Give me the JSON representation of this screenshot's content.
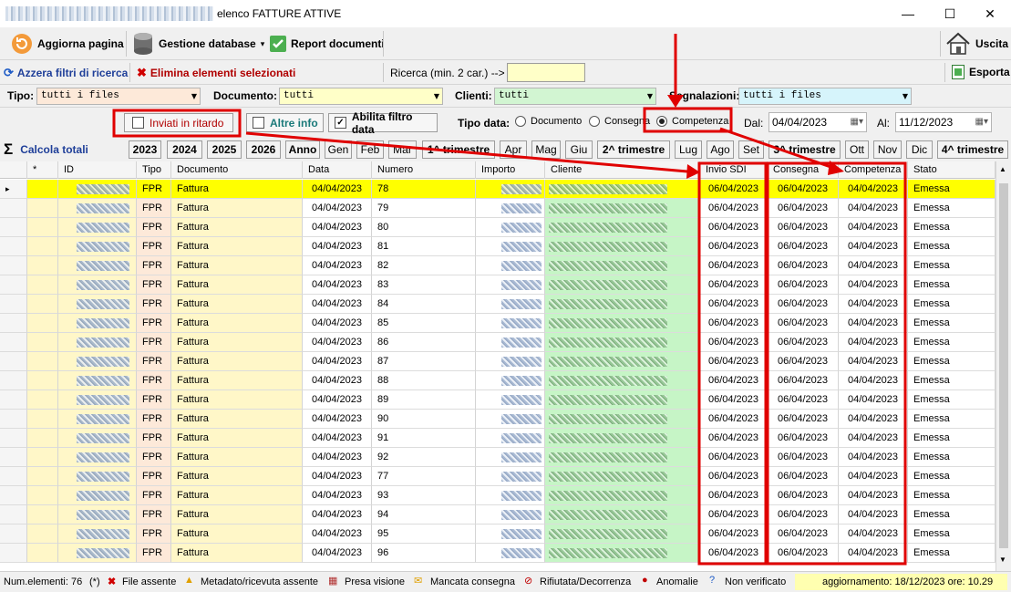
{
  "window": {
    "title": "elenco FATTURE ATTIVE",
    "minimize": "—",
    "maximize": "☐",
    "close": "✕"
  },
  "toolbar": {
    "refresh_label": "Aggiorna pagina",
    "db_label": "Gestione database",
    "db_arrow": "▾",
    "report_label": "Report documenti",
    "exit_label": "Uscita"
  },
  "filters_bar": {
    "reset_label": "Azzera filtri di ricerca",
    "delete_label": "Elimina elementi selezionati",
    "search_label": "Ricerca  (min. 2 car.) -->",
    "search_value": "",
    "export_label": "Esporta"
  },
  "combos": {
    "tipo_label": "Tipo:",
    "tipo_value": "tutti i files",
    "documento_label": "Documento:",
    "documento_value": "tutti",
    "clienti_label": "Clienti:",
    "clienti_value": "tutti",
    "segnalazioni_label": "Segnalazioni:",
    "segnalazioni_value": "tutti i files"
  },
  "options": {
    "ritardo_label": "Inviati in ritardo",
    "altre_label": "Altre info",
    "abilita_label": "Abilita filtro data",
    "tipo_data_label": "Tipo data:",
    "radio_documento": "Documento",
    "radio_consegna": "Consegna",
    "radio_competenza": "Competenza",
    "dal_label": "Dal:",
    "dal_value": "04/04/2023",
    "al_label": "Al:",
    "al_value": "11/12/2023"
  },
  "periods": {
    "calc_label": "Calcola totali",
    "buttons": [
      "2023",
      "2024",
      "2025",
      "2026",
      "Anno",
      "Gen",
      "Feb",
      "Mar",
      "1^ trimestre",
      "Apr",
      "Mag",
      "Giu",
      "2^ trimestre",
      "Lug",
      "Ago",
      "Set",
      "3^ trimestre",
      "Ott",
      "Nov",
      "Dic",
      "4^ trimestre"
    ]
  },
  "grid": {
    "headers": [
      "*",
      "ID",
      "Tipo",
      "Documento",
      "Data",
      "Numero",
      "Importo",
      "Cliente",
      "Invio SDI",
      "Consegna",
      "Competenza",
      "Stato"
    ],
    "rows": [
      {
        "tipo": "FPR",
        "doc": "Fattura",
        "data": "04/04/2023",
        "num": "78",
        "sdi": "06/04/2023",
        "cons": "06/04/2023",
        "comp": "04/04/2023",
        "stato": "Emessa"
      },
      {
        "tipo": "FPR",
        "doc": "Fattura",
        "data": "04/04/2023",
        "num": "79",
        "sdi": "06/04/2023",
        "cons": "06/04/2023",
        "comp": "04/04/2023",
        "stato": "Emessa"
      },
      {
        "tipo": "FPR",
        "doc": "Fattura",
        "data": "04/04/2023",
        "num": "80",
        "sdi": "06/04/2023",
        "cons": "06/04/2023",
        "comp": "04/04/2023",
        "stato": "Emessa"
      },
      {
        "tipo": "FPR",
        "doc": "Fattura",
        "data": "04/04/2023",
        "num": "81",
        "sdi": "06/04/2023",
        "cons": "06/04/2023",
        "comp": "04/04/2023",
        "stato": "Emessa"
      },
      {
        "tipo": "FPR",
        "doc": "Fattura",
        "data": "04/04/2023",
        "num": "82",
        "sdi": "06/04/2023",
        "cons": "06/04/2023",
        "comp": "04/04/2023",
        "stato": "Emessa"
      },
      {
        "tipo": "FPR",
        "doc": "Fattura",
        "data": "04/04/2023",
        "num": "83",
        "sdi": "06/04/2023",
        "cons": "06/04/2023",
        "comp": "04/04/2023",
        "stato": "Emessa"
      },
      {
        "tipo": "FPR",
        "doc": "Fattura",
        "data": "04/04/2023",
        "num": "84",
        "sdi": "06/04/2023",
        "cons": "06/04/2023",
        "comp": "04/04/2023",
        "stato": "Emessa"
      },
      {
        "tipo": "FPR",
        "doc": "Fattura",
        "data": "04/04/2023",
        "num": "85",
        "sdi": "06/04/2023",
        "cons": "06/04/2023",
        "comp": "04/04/2023",
        "stato": "Emessa"
      },
      {
        "tipo": "FPR",
        "doc": "Fattura",
        "data": "04/04/2023",
        "num": "86",
        "sdi": "06/04/2023",
        "cons": "06/04/2023",
        "comp": "04/04/2023",
        "stato": "Emessa"
      },
      {
        "tipo": "FPR",
        "doc": "Fattura",
        "data": "04/04/2023",
        "num": "87",
        "sdi": "06/04/2023",
        "cons": "06/04/2023",
        "comp": "04/04/2023",
        "stato": "Emessa"
      },
      {
        "tipo": "FPR",
        "doc": "Fattura",
        "data": "04/04/2023",
        "num": "88",
        "sdi": "06/04/2023",
        "cons": "06/04/2023",
        "comp": "04/04/2023",
        "stato": "Emessa"
      },
      {
        "tipo": "FPR",
        "doc": "Fattura",
        "data": "04/04/2023",
        "num": "89",
        "sdi": "06/04/2023",
        "cons": "06/04/2023",
        "comp": "04/04/2023",
        "stato": "Emessa"
      },
      {
        "tipo": "FPR",
        "doc": "Fattura",
        "data": "04/04/2023",
        "num": "90",
        "sdi": "06/04/2023",
        "cons": "06/04/2023",
        "comp": "04/04/2023",
        "stato": "Emessa"
      },
      {
        "tipo": "FPR",
        "doc": "Fattura",
        "data": "04/04/2023",
        "num": "91",
        "sdi": "06/04/2023",
        "cons": "06/04/2023",
        "comp": "04/04/2023",
        "stato": "Emessa"
      },
      {
        "tipo": "FPR",
        "doc": "Fattura",
        "data": "04/04/2023",
        "num": "92",
        "sdi": "06/04/2023",
        "cons": "06/04/2023",
        "comp": "04/04/2023",
        "stato": "Emessa"
      },
      {
        "tipo": "FPR",
        "doc": "Fattura",
        "data": "04/04/2023",
        "num": "77",
        "sdi": "06/04/2023",
        "cons": "06/04/2023",
        "comp": "04/04/2023",
        "stato": "Emessa"
      },
      {
        "tipo": "FPR",
        "doc": "Fattura",
        "data": "04/04/2023",
        "num": "93",
        "sdi": "06/04/2023",
        "cons": "06/04/2023",
        "comp": "04/04/2023",
        "stato": "Emessa"
      },
      {
        "tipo": "FPR",
        "doc": "Fattura",
        "data": "04/04/2023",
        "num": "94",
        "sdi": "06/04/2023",
        "cons": "06/04/2023",
        "comp": "04/04/2023",
        "stato": "Emessa"
      },
      {
        "tipo": "FPR",
        "doc": "Fattura",
        "data": "04/04/2023",
        "num": "95",
        "sdi": "06/04/2023",
        "cons": "06/04/2023",
        "comp": "04/04/2023",
        "stato": "Emessa"
      },
      {
        "tipo": "FPR",
        "doc": "Fattura",
        "data": "04/04/2023",
        "num": "96",
        "sdi": "06/04/2023",
        "cons": "06/04/2023",
        "comp": "04/04/2023",
        "stato": "Emessa"
      }
    ]
  },
  "status": {
    "count": "Num.elementi: 76",
    "star": "(*)",
    "file_assente": "File assente",
    "metadato": "Metadato/ricevuta assente",
    "presa_visione": "Presa visione",
    "mancata": "Mancata consegna",
    "rifiutata": "Rifiutata/Decorrenza",
    "anomalie": "Anomalie",
    "non_verificato": "Non verificato",
    "aggiornamento": "aggiornamento: 18/12/2023   ore: 10.29"
  },
  "colors": {
    "selected_row": "#ffff00",
    "tipo_col": "#fde9d9",
    "cliente_col": "#c6f5c6",
    "id_col": "#fff7c8",
    "annotation": "#e00000"
  }
}
